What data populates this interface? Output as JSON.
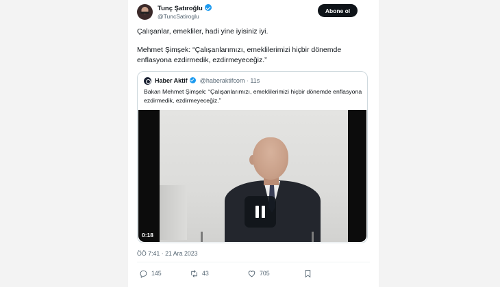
{
  "author": {
    "name": "Tunç Şatıroğlu",
    "handle": "@TuncSatiroglu",
    "verified": true
  },
  "follow_button_label": "Abone ol",
  "tweet": {
    "line1": "Çalışanlar, emekliler, hadi yine iyisiniz iyi.",
    "line2": "Mehmet Şimşek: “Çalışanlarımızı, emeklilerimizi hiçbir dönemde enflasyona ezdirmedik, ezdirmeyeceğiz.”"
  },
  "quoted_tweet": {
    "name": "Haber Aktif",
    "handle": "@haberaktifcom · 11s",
    "verified": true,
    "text": "Bakan Mehmet Şimşek: “Çalışanlarımızı, emeklilerimizi hiçbir dönemde enflasyona ezdirmedik, ezdirmeyeceğiz.”",
    "video": {
      "duration": "0:18",
      "state": "paused"
    }
  },
  "timestamp": "ÖÖ 7:41 · 21 Ara 2023",
  "actions": {
    "reply_count": "145",
    "retweet_count": "43",
    "like_count": "705"
  },
  "icons": {
    "verified": "verified-badge-icon",
    "reply": "reply-icon",
    "retweet": "retweet-icon",
    "like": "heart-icon",
    "bookmark": "bookmark-icon",
    "play": "pause-icon"
  },
  "colors": {
    "verified": "#1d9bf0",
    "follow_button": "#0f1419",
    "secondary_text": "#536471"
  }
}
